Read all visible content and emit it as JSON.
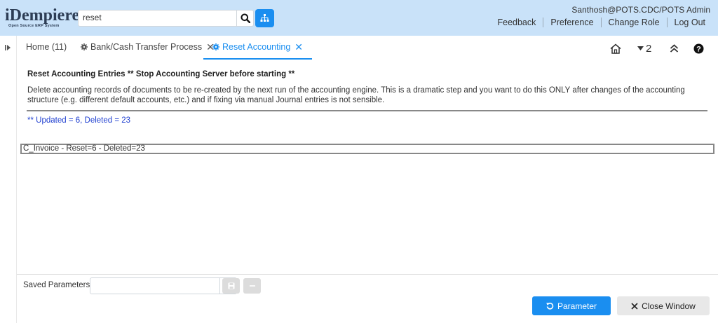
{
  "header": {
    "logo_main": "iDempiere",
    "logo_sub": "Open Source ERP System",
    "search_value": "reset",
    "user": "Santhosh@POTS.CDC/POTS Admin",
    "links": [
      "Feedback",
      "Preference",
      "Change Role",
      "Log Out"
    ]
  },
  "tabs": [
    {
      "label": "Home (11)"
    },
    {
      "label": "Bank/Cash Transfer Process"
    },
    {
      "label": "Reset Accounting"
    }
  ],
  "toolbar": {
    "window_count": "2"
  },
  "process": {
    "title": "Reset Accounting Entries ** Stop Accounting Server before starting **",
    "description": "Delete accounting records of documents to be re-created by the next run of the accounting engine. This is a dramatic step and you want to do this ONLY after changes of the accounting structure (e.g. different default accounts, etc.) and if fixing via manual Journal entries is not sensible.",
    "result": "** Updated = 6, Deleted = 23",
    "log_line": "C_Invoice - Reset=6 - Deleted=23"
  },
  "footer": {
    "saved_parameters_label": "Saved Parameters",
    "parameter_button": "Parameter",
    "close_button": "Close Window"
  },
  "colors": {
    "header_bg": "#c9e2f9",
    "accent": "#1a8ef0",
    "result_text": "#1f3fd0"
  },
  "icons": {
    "search": "search-icon",
    "tree": "sitemap-icon",
    "home": "home-icon",
    "collapse": "double-chevron-up-icon",
    "help": "question-circle-icon"
  }
}
